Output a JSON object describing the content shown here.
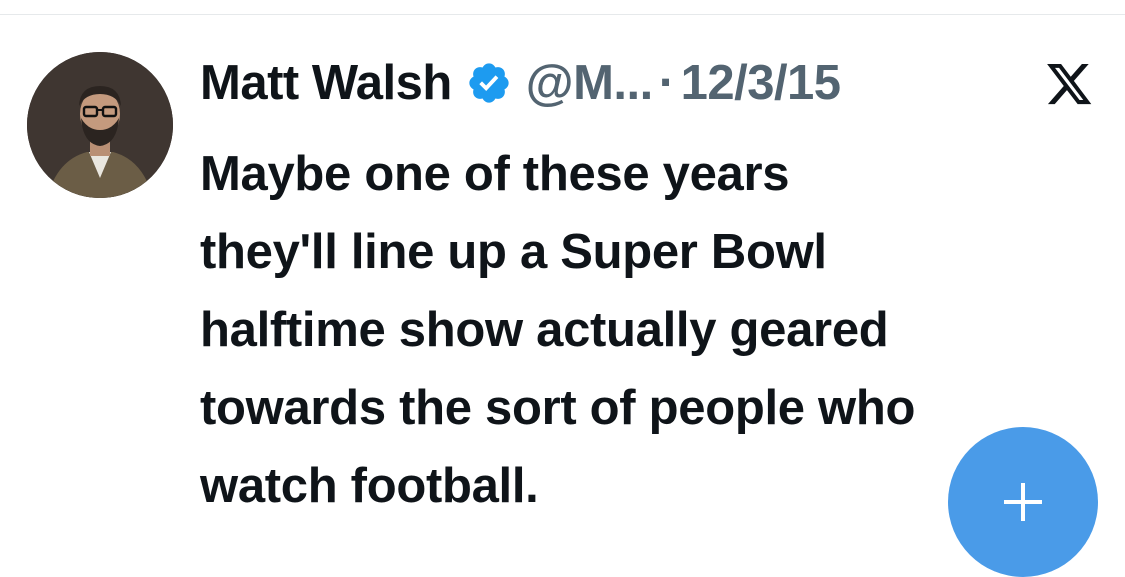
{
  "tweet": {
    "author_name": "Matt Walsh",
    "handle": "@M...",
    "separator": "·",
    "date": "12/3/15",
    "verified_icon": "verified-badge-icon",
    "platform_icon": "x-logo-icon",
    "text_lines": [
      "Maybe one of these years",
      "they'll line up a Super Bowl",
      "halftime show actually geared",
      "towards the sort of people who",
      "watch football."
    ]
  },
  "compose_button": {
    "icon": "plus-icon",
    "color": "#4a9be8"
  },
  "colors": {
    "text": "#0f1419",
    "secondary": "#536471",
    "verified": "#1d9bf0"
  }
}
